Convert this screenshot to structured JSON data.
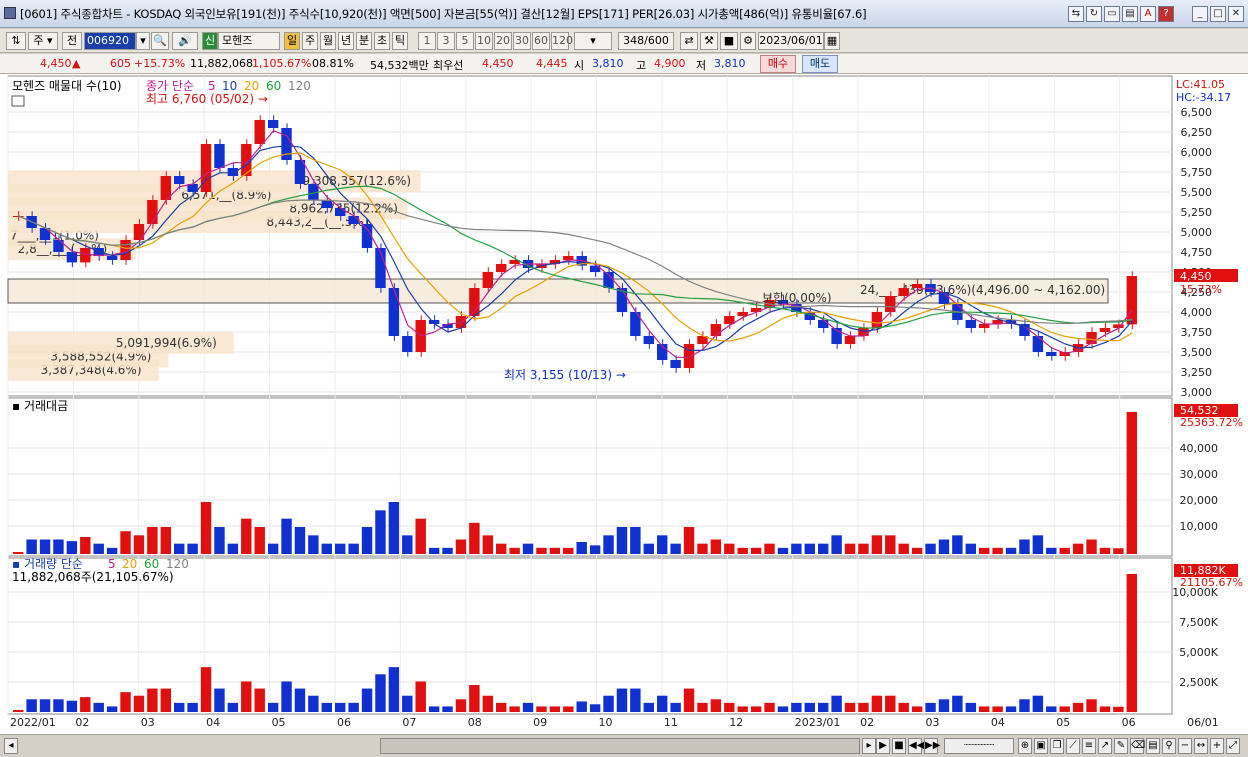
{
  "window": {
    "title": "[0601] 주식종합차트 - KOSDAQ 외국인보유[191(천)] 주식수[10,920(천)] 액면[500] 자본금[55(억)] 결산[12월] EPS[171] PER[26.03] 시가총액[486(억)] 유통비율[67.6]"
  },
  "toolbar": {
    "period_select": "주",
    "prev_label": "전",
    "code": "006920",
    "stock_badge": "신",
    "stock_name": "모헨즈",
    "periods": [
      "일",
      "주",
      "월",
      "년",
      "분",
      "초",
      "틱"
    ],
    "intervals": [
      "1",
      "3",
      "5",
      "10",
      "20",
      "30",
      "60",
      "120"
    ],
    "count_value": "348",
    "count_total": "/600",
    "date": "2023/06/01"
  },
  "quote": {
    "price": "4,450",
    "change": "605",
    "change_pct": "+15.73%",
    "volume": "11,882,068",
    "volume_pct": "1,105.67%",
    "turnover": "08.81%",
    "amount": "54,532백만",
    "best_label": "최우선",
    "best_ask": "4,450",
    "best_bid": "4,445",
    "open_label": "시",
    "open": "3,810",
    "high_label": "고",
    "high": "4,900",
    "low_label": "저",
    "low": "3,810",
    "buy_label": "매수",
    "sell_label": "매도"
  },
  "panel_price": {
    "title": "모헨즈 매물대 수(10)",
    "ma_label": "종가 단순",
    "ma_periods": [
      "5",
      "10",
      "20",
      "60",
      "120"
    ],
    "ma_colors": [
      "#c02090",
      "#1a3fa8",
      "#e8a000",
      "#20a040",
      "#808080"
    ],
    "max_note": "최고 6,760 (05/02)",
    "min_note": "최저 3,155 (10/13)",
    "lc": "LC:41.05",
    "hc": "HC:-34.17",
    "current_price": "4,450",
    "current_pct": "15.73%",
    "y_ticks": [
      "6,500",
      "6,250",
      "6,000",
      "5,750",
      "5,500",
      "5,250",
      "5,000",
      "4,750",
      "4,500",
      "4,250",
      "4,000",
      "3,750",
      "3,500",
      "3,250",
      "3,000"
    ],
    "volume_profile": [
      {
        "price": 3300,
        "label": "3,387,348(4.6%)",
        "pct": 4.6
      },
      {
        "price": 3470,
        "label": "3,588,552(4.9%)",
        "pct": 4.9
      },
      {
        "price": 3640,
        "label": "5,091,994(6.9%)",
        "pct": 6.9
      },
      {
        "price": 4810,
        "label": "2,8__,___(_._%)",
        "pct": 3.9
      },
      {
        "price": 4980,
        "label": "7___,__1(1.0%)",
        "pct": 1.0
      },
      {
        "price": 5150,
        "label": "8,443,2__(__.5%)",
        "pct": 11.5
      },
      {
        "price": 5320,
        "label": "8,962,735(12.2%)",
        "pct": 12.2
      },
      {
        "price": 5490,
        "label": "6,571,__(8.9%)",
        "pct": 8.9
      },
      {
        "price": 5660,
        "label": "9,308,357(12.6%)",
        "pct": 12.6
      },
      {
        "price": 4300,
        "label": "24,___,439(33.6%)(4,496.00 ~ 4,162.00)",
        "pct": 33.6
      }
    ],
    "flat_note": "보합(0.00%)"
  },
  "panel_amount": {
    "title": "거래대금",
    "current_value": "54,532",
    "current_pct": "25363.72%",
    "y_ticks": [
      "40,000",
      "30,000",
      "20,000",
      "10,000"
    ]
  },
  "panel_volume": {
    "title": "거래량 단순",
    "ma_periods": [
      "5",
      "20",
      "60",
      "120"
    ],
    "summary": "11,882,068주(21,105.67%)",
    "current_value": "11,882K",
    "current_pct": "21105.67%",
    "y_ticks": [
      "10,000K",
      "7,500K",
      "5,000K",
      "2,500K"
    ]
  },
  "x_axis": [
    "2022/01",
    "02",
    "03",
    "04",
    "05",
    "06",
    "07",
    "08",
    "09",
    "10",
    "11",
    "12",
    "2023/01",
    "02",
    "03",
    "04",
    "05",
    "06",
    "06/01"
  ],
  "chart_data": {
    "type": "candlestick",
    "ylim": [
      3000,
      6800
    ],
    "highlights": {
      "high": 6760,
      "low": 3155,
      "last": 4450
    },
    "series": [
      {
        "name": "종가",
        "values": [
          5200,
          5050,
          4900,
          4750,
          4620,
          4800,
          4700,
          4650,
          4900,
          5100,
          5400,
          5700,
          5600,
          5500,
          6100,
          5800,
          5700,
          6100,
          6400,
          6300,
          5900,
          5600,
          5400,
          5300,
          5200,
          5100,
          4800,
          4300,
          3700,
          3500,
          3900,
          3850,
          3800,
          3950,
          4300,
          4500,
          4600,
          4650,
          4550,
          4600,
          4650,
          4700,
          4580,
          4500,
          4300,
          4000,
          3700,
          3600,
          3400,
          3300,
          3600,
          3700,
          3850,
          3950,
          4000,
          4050,
          4150,
          4100,
          4000,
          3900,
          3800,
          3600,
          3700,
          3800,
          4000,
          4200,
          4300,
          4350,
          4250,
          4100,
          3900,
          3800,
          3850,
          3900,
          3850,
          3700,
          3500,
          3450,
          3500,
          3600,
          3750,
          3800,
          3845,
          4450
        ]
      }
    ]
  }
}
